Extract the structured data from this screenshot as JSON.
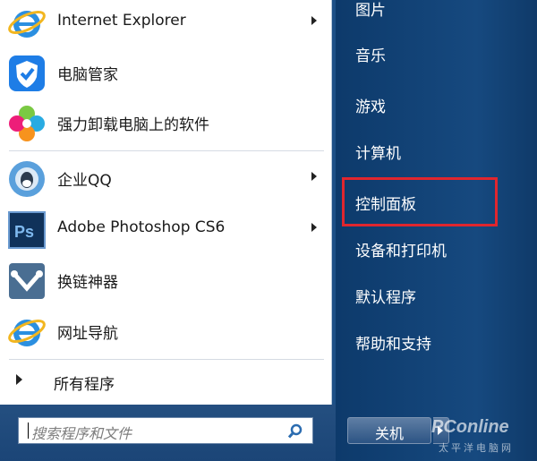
{
  "start_menu": {
    "programs": [
      {
        "label": "Internet Explorer",
        "icon": "internet-explorer-icon",
        "has_submenu": true
      },
      {
        "label": "电脑管家",
        "icon": "pc-manager-icon",
        "has_submenu": false
      },
      {
        "label": "强力卸载电脑上的软件",
        "icon": "uninstaller-icon",
        "has_submenu": false
      },
      {
        "label": "企业QQ",
        "icon": "enterprise-qq-icon",
        "has_submenu": true
      },
      {
        "label": "Adobe Photoshop CS6",
        "icon": "photoshop-icon",
        "has_submenu": true
      },
      {
        "label": "换链神器",
        "icon": "link-tool-icon",
        "has_submenu": false
      },
      {
        "label": "网址导航",
        "icon": "internet-explorer-icon",
        "has_submenu": false
      }
    ],
    "all_programs": "所有程序",
    "search": {
      "placeholder": "搜索程序和文件"
    },
    "right_items": [
      "图片",
      "音乐",
      "游戏",
      "计算机",
      "控制面板",
      "设备和打印机",
      "默认程序",
      "帮助和支持"
    ],
    "highlighted_item": "控制面板",
    "highlight_color": "#e0262e",
    "shutdown_label": "关机"
  },
  "watermark": {
    "brand": "PConline",
    "sub": "太平洋电脑网"
  }
}
